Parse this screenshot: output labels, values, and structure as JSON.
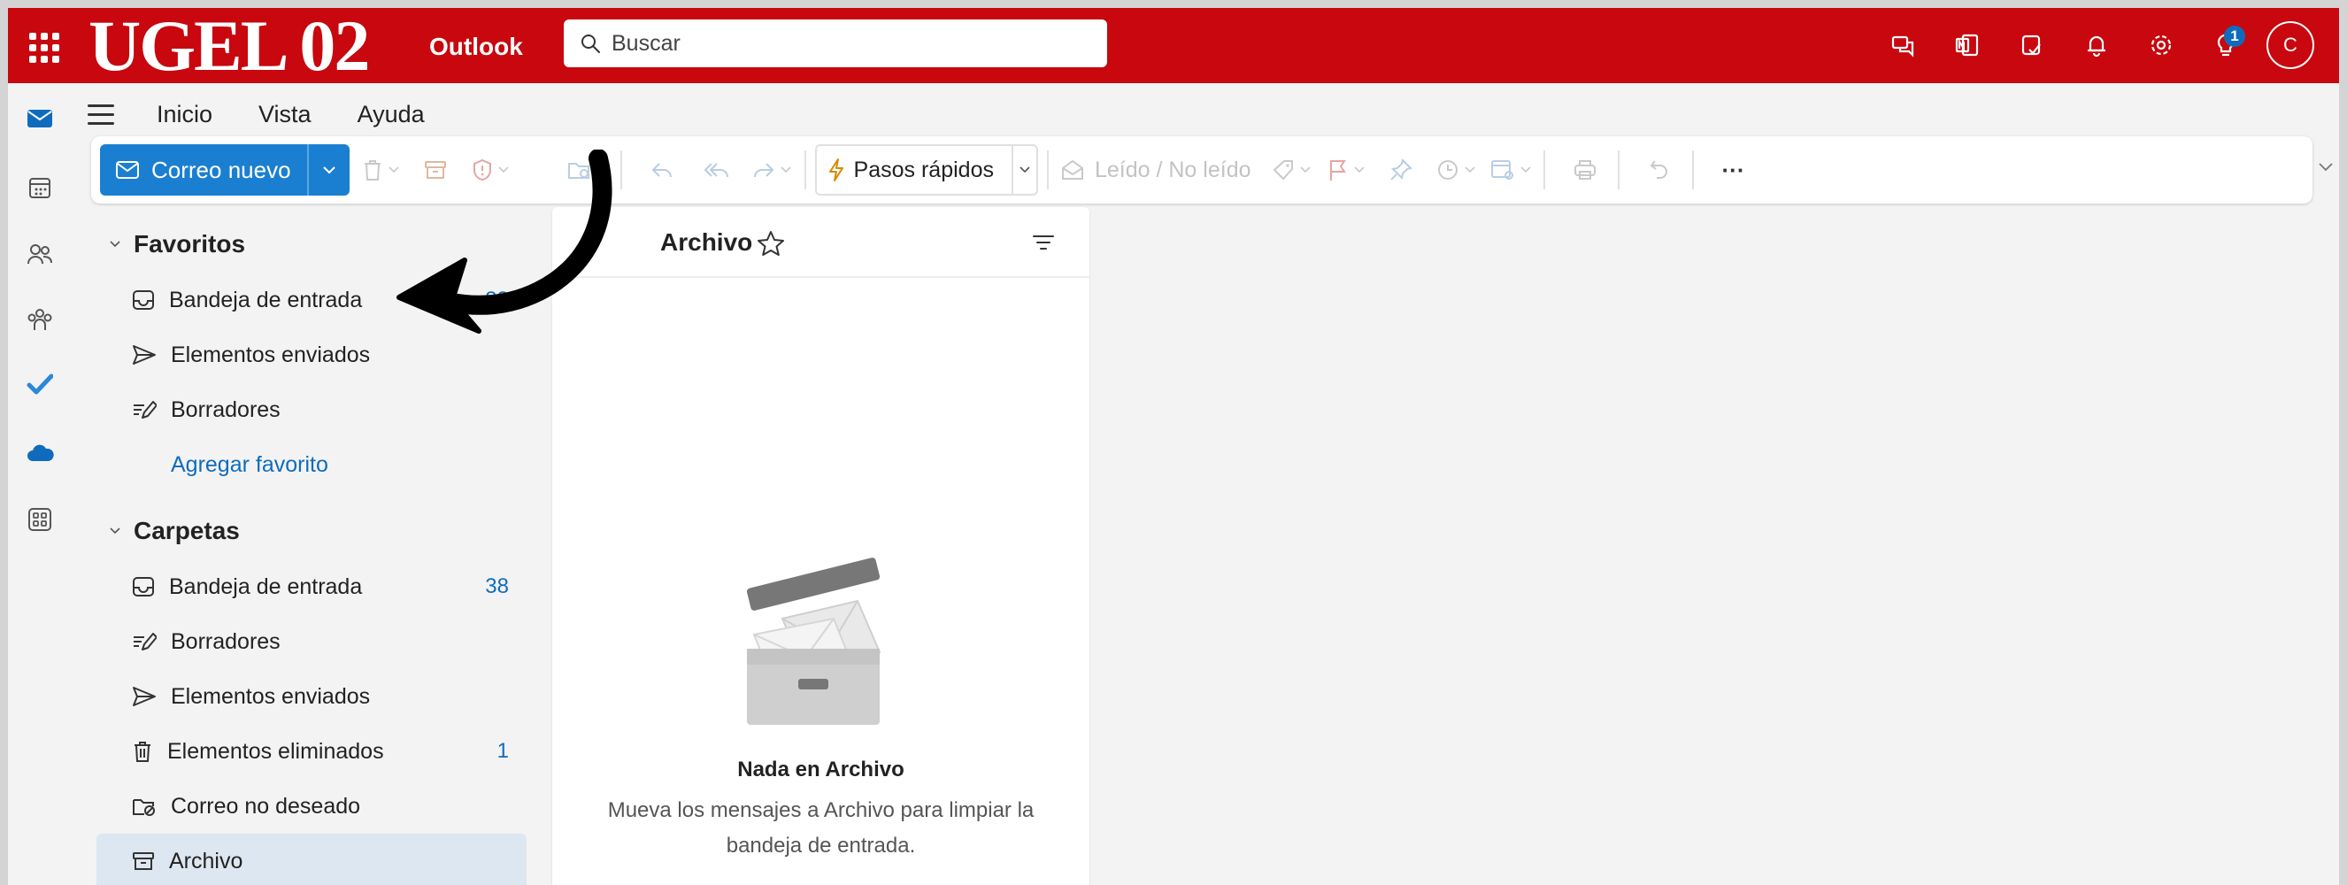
{
  "topbar": {
    "logo_text": "UGEL 02",
    "app_name": "Outlook",
    "search_placeholder": "Buscar",
    "notification_count": "1",
    "avatar_initial": "C",
    "colors": {
      "brand": "#c8070e",
      "accent": "#0f6cbd"
    }
  },
  "rail": {
    "items": [
      "mail-icon",
      "calendar-icon",
      "people-icon",
      "groups-icon",
      "todo-icon",
      "onedrive-icon",
      "apps-icon"
    ]
  },
  "ribbon": {
    "tabs": [
      "Inicio",
      "Vista",
      "Ayuda"
    ],
    "active_tab": "Inicio"
  },
  "toolbar": {
    "new_mail_label": "Correo nuevo",
    "quick_steps_label": "Pasos rápidos",
    "read_unread_label": "Leído / No leído",
    "more_label": "···"
  },
  "folders": {
    "favorites_header": "Favoritos",
    "favorites": [
      {
        "label": "Bandeja de entrada",
        "count": "38"
      },
      {
        "label": "Elementos enviados",
        "count": ""
      },
      {
        "label": "Borradores",
        "count": ""
      }
    ],
    "add_favorite": "Agregar favorito",
    "folders_header": "Carpetas",
    "items": [
      {
        "label": "Bandeja de entrada",
        "count": "38"
      },
      {
        "label": "Borradores",
        "count": ""
      },
      {
        "label": "Elementos enviados",
        "count": ""
      },
      {
        "label": "Elementos eliminados",
        "count": "1"
      },
      {
        "label": "Correo no deseado",
        "count": ""
      },
      {
        "label": "Archivo",
        "count": ""
      }
    ],
    "selected": "Archivo"
  },
  "message_list": {
    "title": "Archivo",
    "empty_title": "Nada en Archivo",
    "empty_description": "Mueva los mensajes a Archivo para limpiar la bandeja de entrada."
  }
}
